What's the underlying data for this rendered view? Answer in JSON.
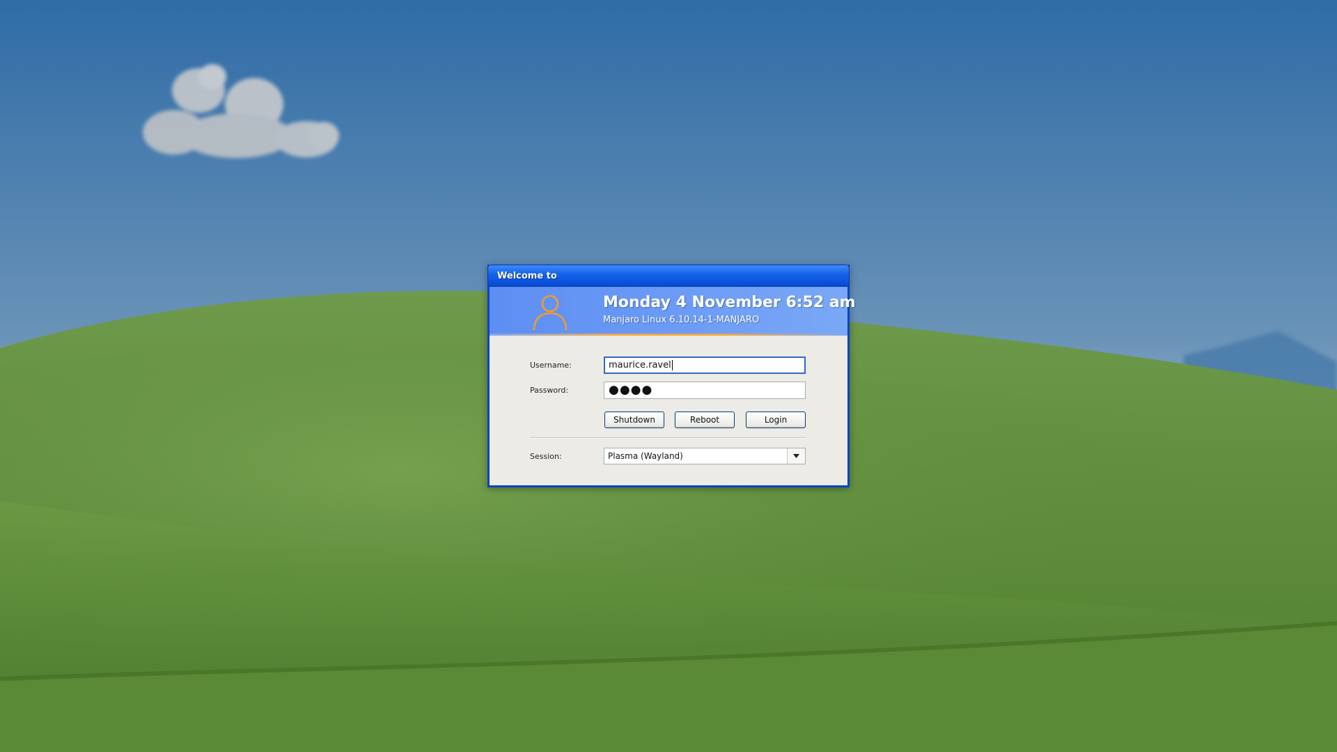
{
  "window": {
    "title": "Welcome to"
  },
  "banner": {
    "datetime": "Monday 4 November  6:52 am",
    "system": "Manjaro Linux 6.10.14-1-MANJARO",
    "icon": "user-icon"
  },
  "form": {
    "username_label": "Username:",
    "username_value": "maurice.ravel",
    "password_label": "Password:",
    "password_mask": "●●●●",
    "session_label": "Session:",
    "session_value": "Plasma (Wayland)",
    "session_dropdown_icon": "chevron-down-icon"
  },
  "buttons": {
    "shutdown": "Shutdown",
    "reboot": "Reboot",
    "login": "Login"
  },
  "colors": {
    "titlebar": "#0a4fd8",
    "banner": "#6c9cf6",
    "accent_orange": "#f0a64a",
    "panel": "#ecebe6"
  }
}
